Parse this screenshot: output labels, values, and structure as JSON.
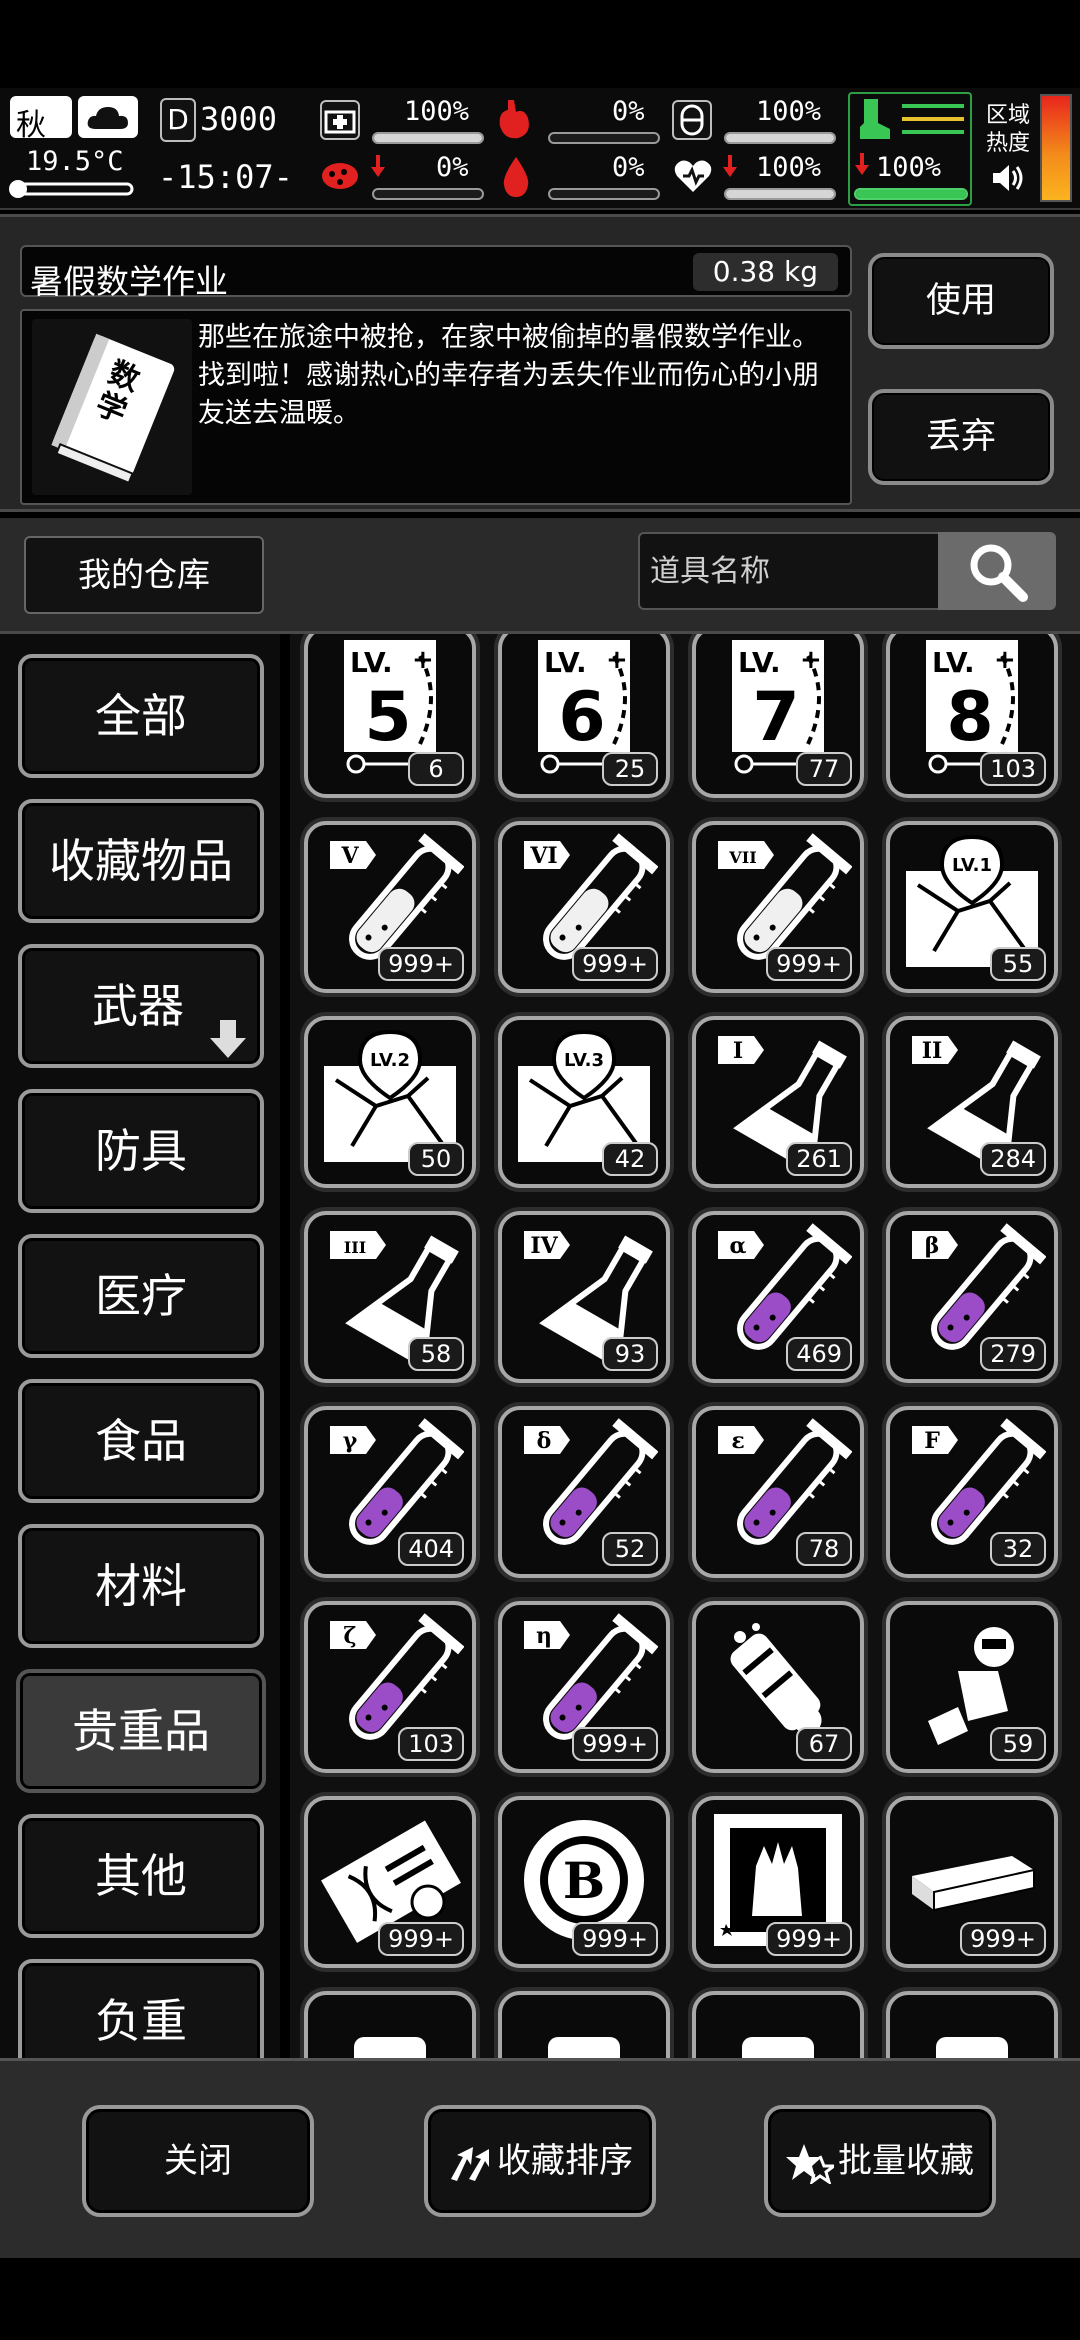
{
  "status": {
    "season": "秋",
    "temperature": "19.5°C",
    "day_counter": "3000",
    "clock": "-15:07-",
    "stats": [
      {
        "name": "health",
        "value": "100%",
        "fill": 1.0
      },
      {
        "name": "hunger",
        "value": "0%",
        "fill": 0.0
      },
      {
        "name": "sanity",
        "value": "100%",
        "fill": 1.0
      },
      {
        "name": "infection",
        "value": "0%",
        "fill": 0.0
      },
      {
        "name": "bleeding",
        "value": "0%",
        "fill": 0.0
      },
      {
        "name": "mood",
        "value": "100%",
        "fill": 1.0
      },
      {
        "name": "stamina",
        "value": "100%",
        "fill": 1.0
      }
    ],
    "zone_heat_label": "区域\n热度"
  },
  "selected_item": {
    "name": "暑假数学作业",
    "weight": "0.38 kg",
    "thumb_text": "数学",
    "description": "那些在旅途中被抢，在家中被偷掉的暑假数学作业。找到啦！感谢热心的幸存者为丢失作业而伤心的小朋友送去温暖。",
    "use_label": "使用",
    "discard_label": "丢弃"
  },
  "warehouse": {
    "label": "我的仓库",
    "search_placeholder": "道具名称"
  },
  "categories": [
    {
      "label": "全部"
    },
    {
      "label": "收藏物品"
    },
    {
      "label": "武器"
    },
    {
      "label": "防具"
    },
    {
      "label": "医疗"
    },
    {
      "label": "食品"
    },
    {
      "label": "材料"
    },
    {
      "label": "贵重品"
    },
    {
      "label": "其他"
    },
    {
      "label": "负重"
    }
  ],
  "active_category": "贵重品",
  "items": [
    {
      "icon": "level-ticket-icon",
      "tag": "LV.",
      "num": "5",
      "qty": "6"
    },
    {
      "icon": "level-ticket-icon",
      "tag": "LV.",
      "num": "6",
      "qty": "25"
    },
    {
      "icon": "level-ticket-icon",
      "tag": "LV.",
      "num": "7",
      "qty": "77"
    },
    {
      "icon": "level-ticket-icon",
      "tag": "LV.",
      "num": "8",
      "qty": "103"
    },
    {
      "icon": "test-tube-icon",
      "tag": "V",
      "qty": "999+"
    },
    {
      "icon": "test-tube-icon",
      "tag": "VI",
      "qty": "999+"
    },
    {
      "icon": "test-tube-icon",
      "tag": "VII",
      "qty": "999+"
    },
    {
      "icon": "map-icon",
      "tag": "LV.1",
      "qty": "55"
    },
    {
      "icon": "map-icon",
      "tag": "LV.2",
      "qty": "50"
    },
    {
      "icon": "map-icon",
      "tag": "LV.3",
      "qty": "42"
    },
    {
      "icon": "flask-icon",
      "tag": "I",
      "qty": "261"
    },
    {
      "icon": "flask-icon",
      "tag": "II",
      "qty": "284"
    },
    {
      "icon": "flask-icon",
      "tag": "III",
      "qty": "58"
    },
    {
      "icon": "flask-icon",
      "tag": "IV",
      "qty": "93"
    },
    {
      "icon": "purple-test-tube-icon",
      "tag": "α",
      "qty": "469"
    },
    {
      "icon": "purple-test-tube-icon",
      "tag": "β",
      "qty": "279"
    },
    {
      "icon": "purple-test-tube-icon",
      "tag": "γ",
      "qty": "404"
    },
    {
      "icon": "purple-test-tube-icon",
      "tag": "δ",
      "qty": "52"
    },
    {
      "icon": "purple-test-tube-icon",
      "tag": "ε",
      "qty": "78"
    },
    {
      "icon": "purple-test-tube-icon",
      "tag": "F",
      "qty": "32"
    },
    {
      "icon": "purple-test-tube-icon",
      "tag": "ζ",
      "qty": "103"
    },
    {
      "icon": "purple-test-tube-icon",
      "tag": "η",
      "qty": "999+"
    },
    {
      "icon": "robot-arm-icon",
      "tag": "",
      "qty": "67"
    },
    {
      "icon": "robot-wreck-icon",
      "tag": "",
      "qty": "59"
    },
    {
      "icon": "dna-certificate-icon",
      "tag": "",
      "qty": "999+"
    },
    {
      "icon": "bitcoin-chip-icon",
      "tag": "",
      "qty": "999+"
    },
    {
      "icon": "zombie-card-icon",
      "tag": "",
      "qty": "999+"
    },
    {
      "icon": "cash-stack-icon",
      "tag": "",
      "qty": "999+"
    },
    {
      "icon": "cash-bundle-icon",
      "tag": "",
      "qty": ""
    },
    {
      "icon": "vase-icon",
      "tag": "",
      "qty": ""
    },
    {
      "icon": "gem-icon",
      "tag": "",
      "qty": ""
    },
    {
      "icon": "can-icon",
      "tag": "",
      "qty": ""
    }
  ],
  "footer": {
    "close_label": "关闭",
    "sort_label": "收藏排序",
    "batch_label": "批量收藏"
  },
  "colors": {
    "potion_purple": "#9b4dc7",
    "stamina_green": "#39c654",
    "alert_red": "#e0211f"
  }
}
